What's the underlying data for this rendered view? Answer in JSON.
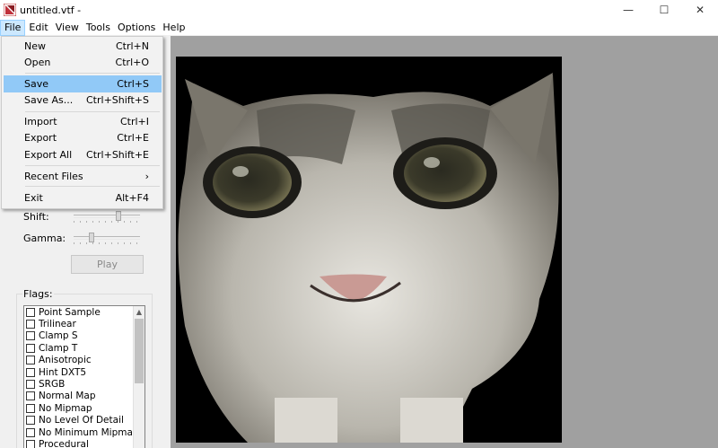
{
  "window": {
    "title": "untitled.vtf -",
    "minimize": "—",
    "maximize": "☐",
    "close": "✕"
  },
  "menubar": [
    "File",
    "Edit",
    "View",
    "Tools",
    "Options",
    "Help"
  ],
  "file_menu": {
    "items": [
      {
        "label": "New",
        "shortcut": "Ctrl+N"
      },
      {
        "label": "Open",
        "shortcut": "Ctrl+O"
      },
      {
        "label": "Save",
        "shortcut": "Ctrl+S",
        "highlighted": true
      },
      {
        "label": "Save As...",
        "shortcut": "Ctrl+Shift+S"
      },
      {
        "label": "Import",
        "shortcut": "Ctrl+I"
      },
      {
        "label": "Export",
        "shortcut": "Ctrl+E"
      },
      {
        "label": "Export All",
        "shortcut": "Ctrl+Shift+E"
      },
      {
        "label": "Recent Files",
        "shortcut": "›"
      },
      {
        "label": "Exit",
        "shortcut": "Alt+F4"
      }
    ]
  },
  "controls": {
    "shift_label": "Shift:",
    "gamma_label": "Gamma:",
    "play_label": "Play"
  },
  "flags": {
    "title": "Flags:",
    "items": [
      "Point Sample",
      "Trilinear",
      "Clamp S",
      "Clamp T",
      "Anisotropic",
      "Hint DXT5",
      "SRGB",
      "Normal Map",
      "No Mipmap",
      "No Level Of Detail",
      "No Minimum Mipmap",
      "Procedural"
    ]
  },
  "colors": {
    "highlight": "#91c9f7",
    "canvas_bg": "#a0a0a0",
    "image_bg": "#000000"
  }
}
